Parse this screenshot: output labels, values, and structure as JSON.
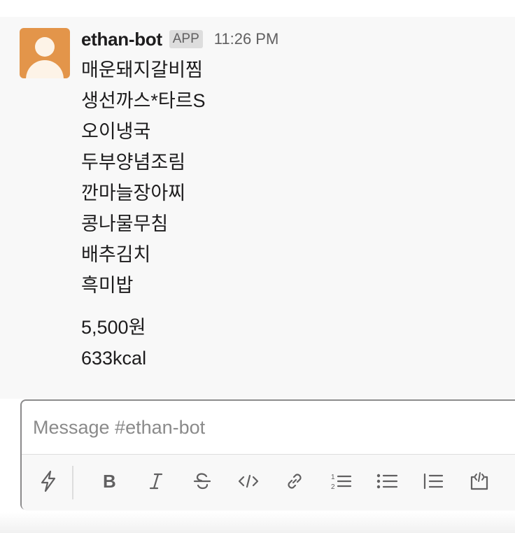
{
  "message": {
    "sender": "ethan-bot",
    "badge": "APP",
    "time": "11:26 PM",
    "menu_items": [
      "매운돼지갈비찜",
      "생선까스*타르S",
      "오이냉국",
      "두부양념조림",
      "깐마늘장아찌",
      "콩나물무침",
      "배추김치",
      "흑미밥"
    ],
    "price": "5,500원",
    "calories": "633kcal"
  },
  "composer": {
    "placeholder": "Message #ethan-bot",
    "toolbar_icons": [
      "shortcuts-lightning-icon",
      "bold-icon",
      "italic-icon",
      "strikethrough-icon",
      "code-icon",
      "link-icon",
      "ordered-list-icon",
      "bulleted-list-icon",
      "blockquote-icon",
      "code-block-icon"
    ]
  },
  "colors": {
    "avatar_bg": "#e3954a",
    "text": "#1d1c1d",
    "muted": "#616061",
    "message_bg": "#f8f8f8"
  }
}
